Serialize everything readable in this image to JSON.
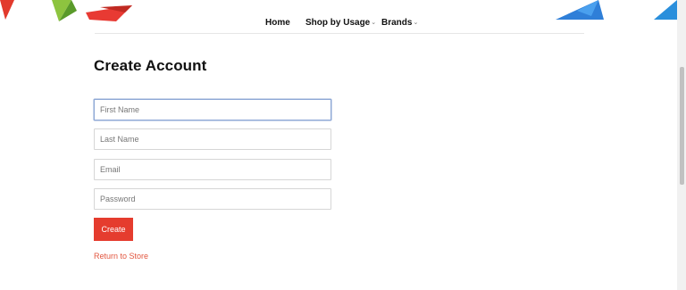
{
  "nav": {
    "items": [
      {
        "label": "Home",
        "has_dropdown": false
      },
      {
        "label": "Shop by Usage",
        "has_dropdown": true
      },
      {
        "label": "Brands",
        "has_dropdown": true
      }
    ],
    "dropdown_glyph": "⌄"
  },
  "form": {
    "title": "Create Account",
    "fields": {
      "first_name": {
        "value": "",
        "placeholder": "First Name"
      },
      "last_name": {
        "value": "",
        "placeholder": "Last Name"
      },
      "email": {
        "value": "",
        "placeholder": "Email"
      },
      "password": {
        "value": "",
        "placeholder": "Password"
      }
    },
    "submit_label": "Create",
    "return_link": "Return to Store"
  },
  "colors": {
    "accent": "#e53c2e",
    "link": "#e2563f",
    "focus_border": "#8fa9d6"
  },
  "icons": {
    "dropdown": "chevron-down-icon"
  }
}
